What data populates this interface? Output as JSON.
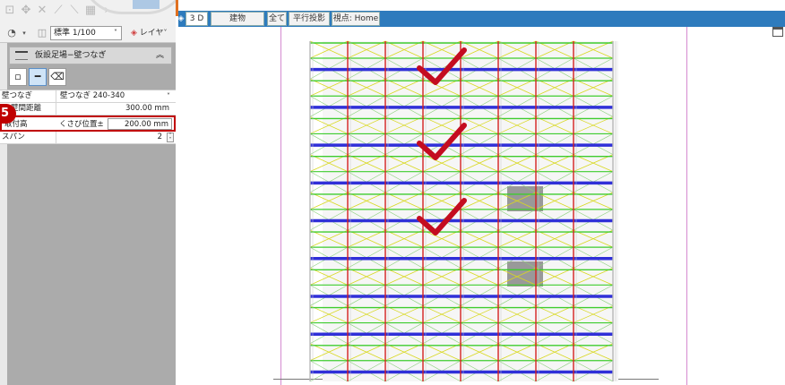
{
  "toolbar": {
    "scale": "標準 1/100",
    "layer": "レイヤ"
  },
  "panel": {
    "title": "仮設足場−壁つなぎ",
    "step_badge": "5",
    "properties": [
      {
        "label": "壁つなぎ",
        "value": "壁つなぎ 240-340"
      },
      {
        "label": "壁間距離",
        "value": "300.00 mm"
      },
      {
        "label": "取付高",
        "sub": "くさび位置±",
        "value": "200.00 mm"
      },
      {
        "label": "スパン",
        "value": "2"
      }
    ]
  },
  "tabs": [
    "3 D",
    "建物",
    "全て",
    "平行投影",
    "視点: Home"
  ],
  "colors": {
    "accent_blue": "#2e7bbd",
    "highlight_red": "#c00000",
    "scaffold_green": "#3ecc2e",
    "scaffold_blue": "#3030d8",
    "scaffold_red": "#d42020",
    "scaffold_yellow": "#d8d820"
  },
  "icons": {
    "checkmark": "checkmark-icon",
    "window": "window-icon"
  }
}
